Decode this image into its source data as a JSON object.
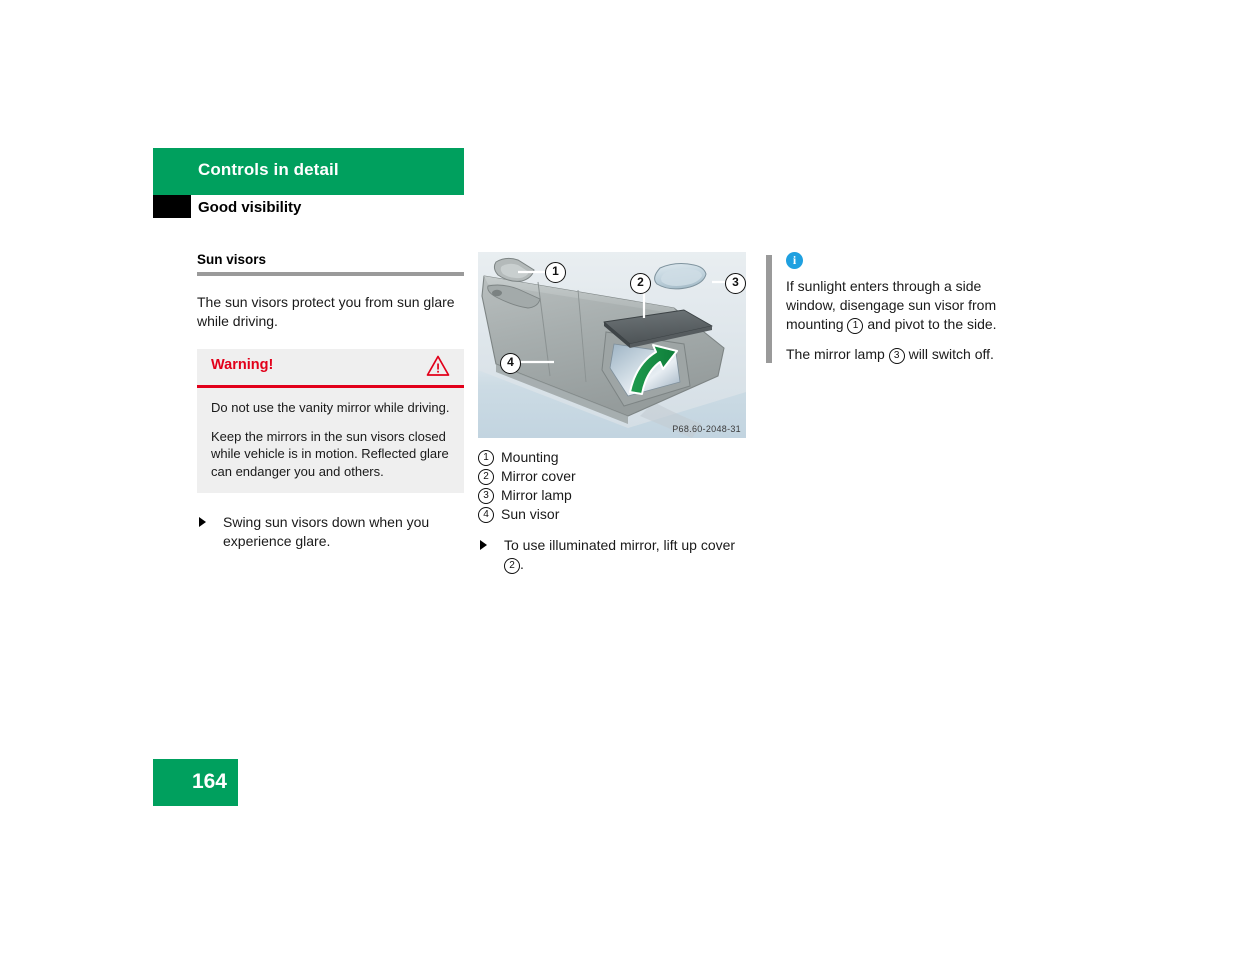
{
  "header": {
    "title": "Controls in detail",
    "subtitle": "Good visibility"
  },
  "left_column": {
    "section_heading": "Sun visors",
    "intro_text": "The sun visors protect you from sun glare while driving.",
    "warning": {
      "label": "Warning!",
      "icon": "warning-triangle-icon",
      "paragraphs": [
        "Do not use the vanity mirror while driving.",
        "Keep the mirrors in the sun visors closed while vehicle is in motion. Reflected glare can endanger you and others."
      ]
    },
    "steps": [
      "Swing sun visors down when you experience glare."
    ]
  },
  "middle_column": {
    "illustration": {
      "alt": "sun-visor-with-illuminated-vanity-mirror",
      "image_code": "P68.60-2048-31",
      "callouts": [
        "1",
        "2",
        "3",
        "4"
      ]
    },
    "legend": [
      {
        "num": "1",
        "label": "Mounting"
      },
      {
        "num": "2",
        "label": "Mirror cover"
      },
      {
        "num": "3",
        "label": "Mirror lamp"
      },
      {
        "num": "4",
        "label": "Sun visor"
      }
    ],
    "step": {
      "text_before": "To use illuminated mirror, lift up cover",
      "ref": "2",
      "text_after": "."
    }
  },
  "right_column": {
    "info_icon": "info-icon",
    "info_icon_glyph": "i",
    "note": {
      "part1_before": "If sunlight enters through a side window, disengage sun visor from mounting",
      "part1_ref": "1",
      "part1_after": "and pivot to the side.",
      "part2_before": "The mirror lamp",
      "part2_ref": "3",
      "part2_after": "will switch off."
    }
  },
  "footer": {
    "page_number": "164"
  },
  "colors": {
    "brand_green": "#00a05e",
    "warning_red": "#e2001a",
    "info_blue": "#1fa0e0",
    "rule_gray": "#9a9a9a",
    "warning_bg": "#efefef"
  }
}
